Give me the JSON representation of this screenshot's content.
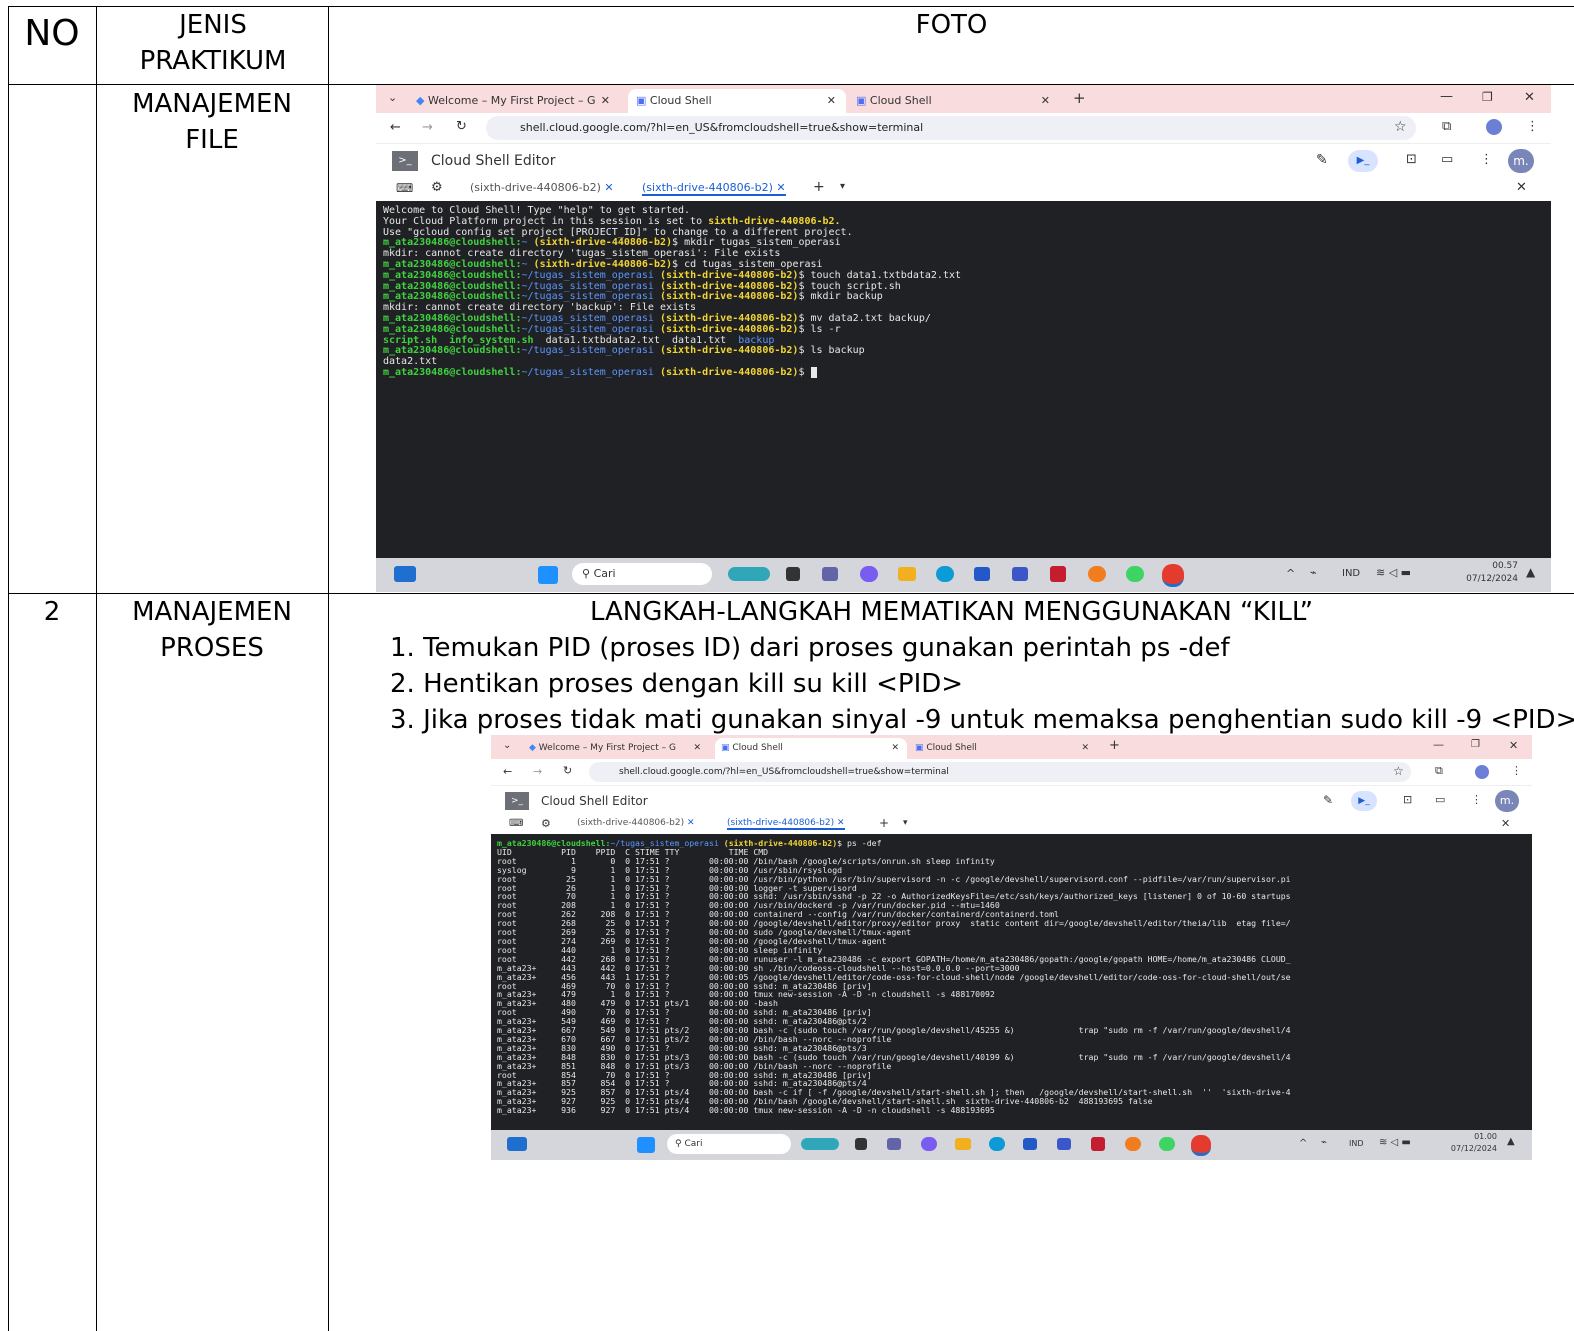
{
  "table": {
    "headers": {
      "no": "NO",
      "jenis": "JENIS PRAKTIKUM",
      "foto": "FOTO"
    },
    "rows": [
      {
        "no": "",
        "jenis": "MANAJEMEN FILE"
      },
      {
        "no": "2",
        "jenis": "MANAJEMEN PROSES"
      }
    ]
  },
  "steps": {
    "title": "LANGKAH-LANGKAH MEMATIKAN MENGGUNAKAN “KILL”",
    "items": [
      "1.  Temukan PID (proses ID) dari proses gunakan perintah ps -def",
      "2.  Hentikan proses dengan kill su kill <PID>",
      "3.  Jika proses tidak mati gunakan sinyal -9 untuk memaksa penghentian sudo kill -9 <PID>"
    ]
  },
  "browser": {
    "tabs": [
      "Welcome – My First Project – G",
      "Cloud Shell",
      "Cloud Shell"
    ],
    "url": "shell.cloud.google.com/?hl=en_US&fromcloudshell=true&show=terminal",
    "editor_title": "Cloud Shell Editor",
    "term_tabs": [
      "(sixth-drive-440806-b2)",
      "(sixth-drive-440806-b2)"
    ],
    "avatar": "m.",
    "search": "Cari",
    "lang": "IND"
  },
  "shot1": {
    "time": "00.57",
    "date": "07/12/2024",
    "lines": [
      "Welcome to Cloud Shell! Type \"help\" to get started.",
      "Your Cloud Platform project in this session is set to sixth-drive-440806-b2.",
      "Use \"gcloud config set project [PROJECT_ID]\" to change to a different project.",
      "m_ata230486@cloudshell:~ (sixth-drive-440806-b2)$ mkdir tugas_sistem_operasi",
      "mkdir: cannot create directory 'tugas_sistem_operasi': File exists",
      "m_ata230486@cloudshell:~ (sixth-drive-440806-b2)$ cd tugas_sistem_operasi",
      "m_ata230486@cloudshell:~/tugas_sistem_operasi (sixth-drive-440806-b2)$ touch data1.txtbdata2.txt",
      "m_ata230486@cloudshell:~/tugas_sistem_operasi (sixth-drive-440806-b2)$ touch script.sh",
      "m_ata230486@cloudshell:~/tugas_sistem_operasi (sixth-drive-440806-b2)$ mkdir backup",
      "mkdir: cannot create directory 'backup': File exists",
      "m_ata230486@cloudshell:~/tugas_sistem_operasi (sixth-drive-440806-b2)$ mv data2.txt backup/",
      "m_ata230486@cloudshell:~/tugas_sistem_operasi (sixth-drive-440806-b2)$ ls -r",
      "script.sh  info_system.sh  data1.txtbdata2.txt  data1.txt  backup",
      "m_ata230486@cloudshell:~/tugas_sistem_operasi (sixth-drive-440806-b2)$ ls backup",
      "data2.txt",
      "m_ata230486@cloudshell:~/tugas_sistem_operasi (sixth-drive-440806-b2)$ "
    ]
  },
  "shot2": {
    "time": "01.00",
    "date": "07/12/2024",
    "lines": [
      "m_ata230486@cloudshell:~/tugas_sistem_operasi (sixth-drive-440806-b2)$ ps -def",
      "UID          PID    PPID  C STIME TTY          TIME CMD",
      "root           1       0  0 17:51 ?        00:00:00 /bin/bash /google/scripts/onrun.sh sleep infinity",
      "syslog         9       1  0 17:51 ?        00:00:00 /usr/sbin/rsyslogd",
      "root          25       1  0 17:51 ?        00:00:00 /usr/bin/python /usr/bin/supervisord -n -c /google/devshell/supervisord.conf --pidfile=/var/run/supervisor.pi",
      "root          26       1  0 17:51 ?        00:00:00 logger -t supervisord",
      "root          70       1  0 17:51 ?        00:00:00 sshd: /usr/sbin/sshd -p 22 -o AuthorizedKeysFile=/etc/ssh/keys/authorized_keys [listener] 0 of 10-60 startups",
      "root         208       1  0 17:51 ?        00:00:00 /usr/bin/dockerd -p /var/run/docker.pid --mtu=1460",
      "root         262     208  0 17:51 ?        00:00:00 containerd --config /var/run/docker/containerd/containerd.toml",
      "root         268      25  0 17:51 ?        00:00:00 /google/devshell/editor/proxy/editor proxy  static content dir=/google/devshell/editor/theia/lib  etag file=/",
      "root         269      25  0 17:51 ?        00:00:00 sudo /google/devshell/tmux-agent",
      "root         274     269  0 17:51 ?        00:00:00 /google/devshell/tmux-agent",
      "root         440       1  0 17:51 ?        00:00:00 sleep infinity",
      "root         442     268  0 17:51 ?        00:00:00 runuser -l m_ata230486 -c export GOPATH=/home/m_ata230486/gopath:/google/gopath HOME=/home/m_ata230486 CLOUD_",
      "m_ata23+     443     442  0 17:51 ?        00:00:00 sh ./bin/codeoss-cloudshell --host=0.0.0.0 --port=3000",
      "m_ata23+     456     443  1 17:51 ?        00:00:05 /google/devshell/editor/code-oss-for-cloud-shell/node /google/devshell/editor/code-oss-for-cloud-shell/out/se",
      "root         469      70  0 17:51 ?        00:00:00 sshd: m_ata230486 [priv]",
      "m_ata23+     479       1  0 17:51 ?        00:00:00 tmux new-session -A -D -n cloudshell -s 488170092",
      "m_ata23+     480     479  0 17:51 pts/1    00:00:00 -bash",
      "root         490      70  0 17:51 ?        00:00:00 sshd: m_ata230486 [priv]",
      "m_ata23+     549     469  0 17:51 ?        00:00:00 sshd: m_ata230486@pts/2",
      "m_ata23+     667     549  0 17:51 pts/2    00:00:00 bash -c (sudo touch /var/run/google/devshell/45255 &)             trap \"sudo rm -f /var/run/google/devshell/4",
      "m_ata23+     670     667  0 17:51 pts/2    00:00:00 /bin/bash --norc --noprofile",
      "m_ata23+     830     490  0 17:51 ?        00:00:00 sshd: m_ata230486@pts/3",
      "m_ata23+     848     830  0 17:51 pts/3    00:00:00 bash -c (sudo touch /var/run/google/devshell/40199 &)             trap \"sudo rm -f /var/run/google/devshell/4",
      "m_ata23+     851     848  0 17:51 pts/3    00:00:00 /bin/bash --norc --noprofile",
      "root         854      70  0 17:51 ?        00:00:00 sshd: m_ata230486 [priv]",
      "m_ata23+     857     854  0 17:51 ?        00:00:00 sshd: m_ata230486@pts/4",
      "m_ata23+     925     857  0 17:51 pts/4    00:00:00 bash -c if [ -f /google/devshell/start-shell.sh ]; then   /google/devshell/start-shell.sh  ''  'sixth-drive-4",
      "m_ata23+     927     925  0 17:51 pts/4    00:00:00 /bin/bash /google/devshell/start-shell.sh  sixth-drive-440806-b2  488193695 false",
      "m_ata23+     936     927  0 17:51 pts/4    00:00:00 tmux new-session -A -D -n cloudshell -s 488193695"
    ]
  }
}
